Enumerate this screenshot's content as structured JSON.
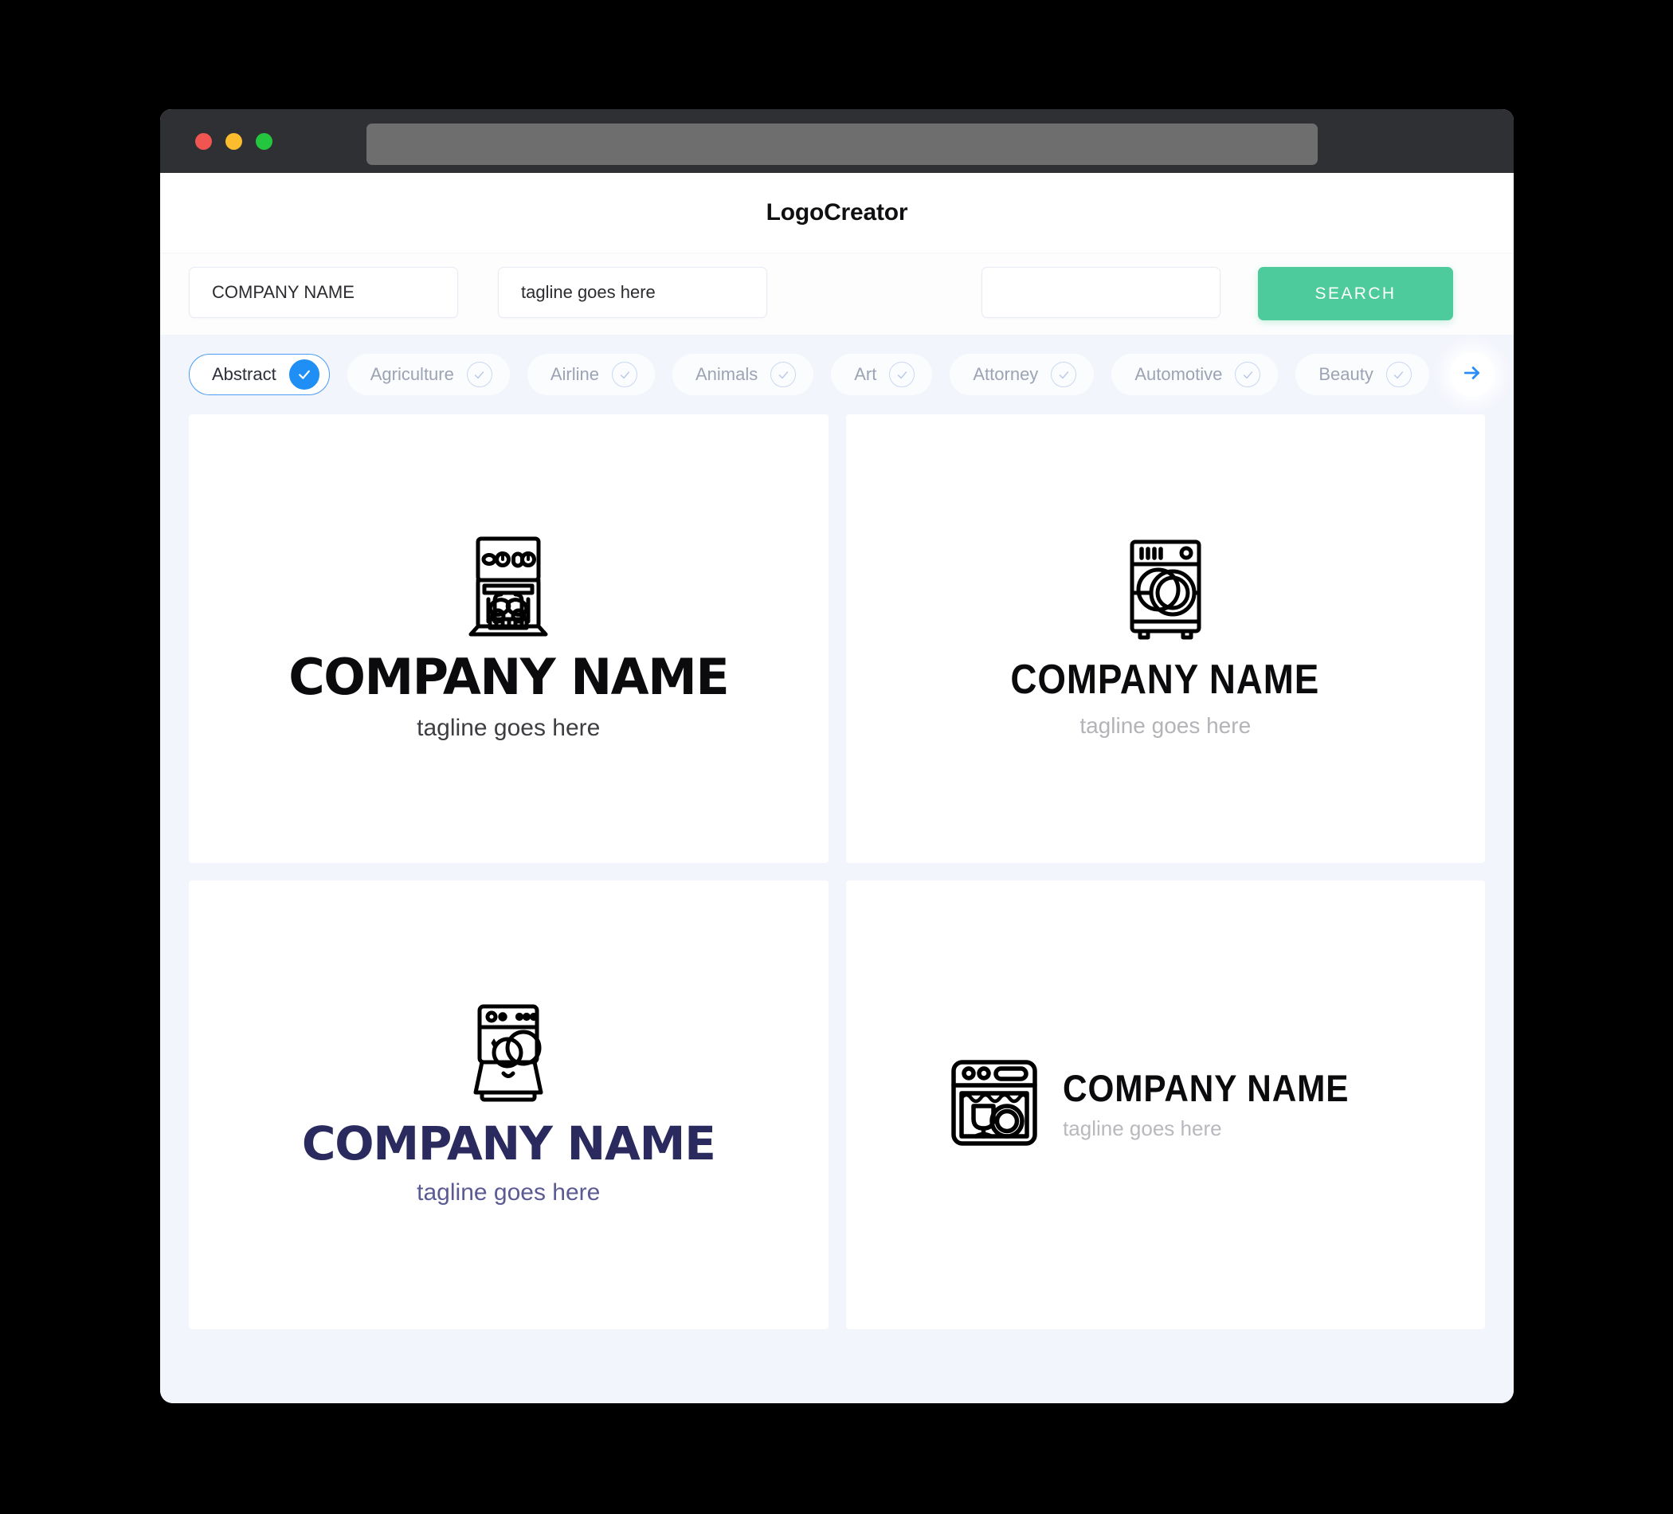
{
  "window": {
    "traffic_lights": [
      {
        "name": "close",
        "color": "#f15551"
      },
      {
        "name": "minimize",
        "color": "#fbbd2e"
      },
      {
        "name": "maximize",
        "color": "#25c63f"
      }
    ],
    "url_value": ""
  },
  "header": {
    "title": "LogoCreator"
  },
  "search": {
    "company_value": "COMPANY NAME",
    "company_placeholder": "COMPANY NAME",
    "tagline_value": "tagline goes here",
    "tagline_placeholder": "tagline goes here",
    "keyword_value": "",
    "keyword_placeholder": "",
    "button_label": "SEARCH",
    "button_color": "#4ecb9c"
  },
  "categories": {
    "active_color": "#1f8ff5",
    "next_arrow_icon": "arrow-right-icon",
    "items": [
      {
        "label": "Abstract",
        "selected": true
      },
      {
        "label": "Agriculture",
        "selected": false
      },
      {
        "label": "Airline",
        "selected": false
      },
      {
        "label": "Animals",
        "selected": false
      },
      {
        "label": "Art",
        "selected": false
      },
      {
        "label": "Attorney",
        "selected": false
      },
      {
        "label": "Automotive",
        "selected": false
      },
      {
        "label": "Beauty",
        "selected": false
      }
    ]
  },
  "results": {
    "cards": [
      {
        "icon": "open-dishwasher-with-dish-rack-icon",
        "name": "COMPANY NAME",
        "tagline": "tagline goes here",
        "name_color": "#0b0b0d",
        "tagline_color": "#3d3d42",
        "layout": "stacked"
      },
      {
        "icon": "front-load-dishwasher-with-plates-icon",
        "name": "COMPANY NAME",
        "tagline": "tagline goes here",
        "name_color": "#0b0b0d",
        "tagline_color": "#b3b3b8",
        "layout": "stacked"
      },
      {
        "icon": "dishwasher-open-door-with-plates-icon",
        "name": "COMPANY NAME",
        "tagline": "tagline goes here",
        "name_color": "#2b2a5e",
        "tagline_color": "#5b5a93",
        "layout": "stacked"
      },
      {
        "icon": "dishwasher-with-glass-and-plate-icon",
        "name": "COMPANY NAME",
        "tagline": "tagline goes here",
        "name_color": "#0b0b0d",
        "tagline_color": "#b8b8bd",
        "layout": "horizontal"
      }
    ]
  }
}
